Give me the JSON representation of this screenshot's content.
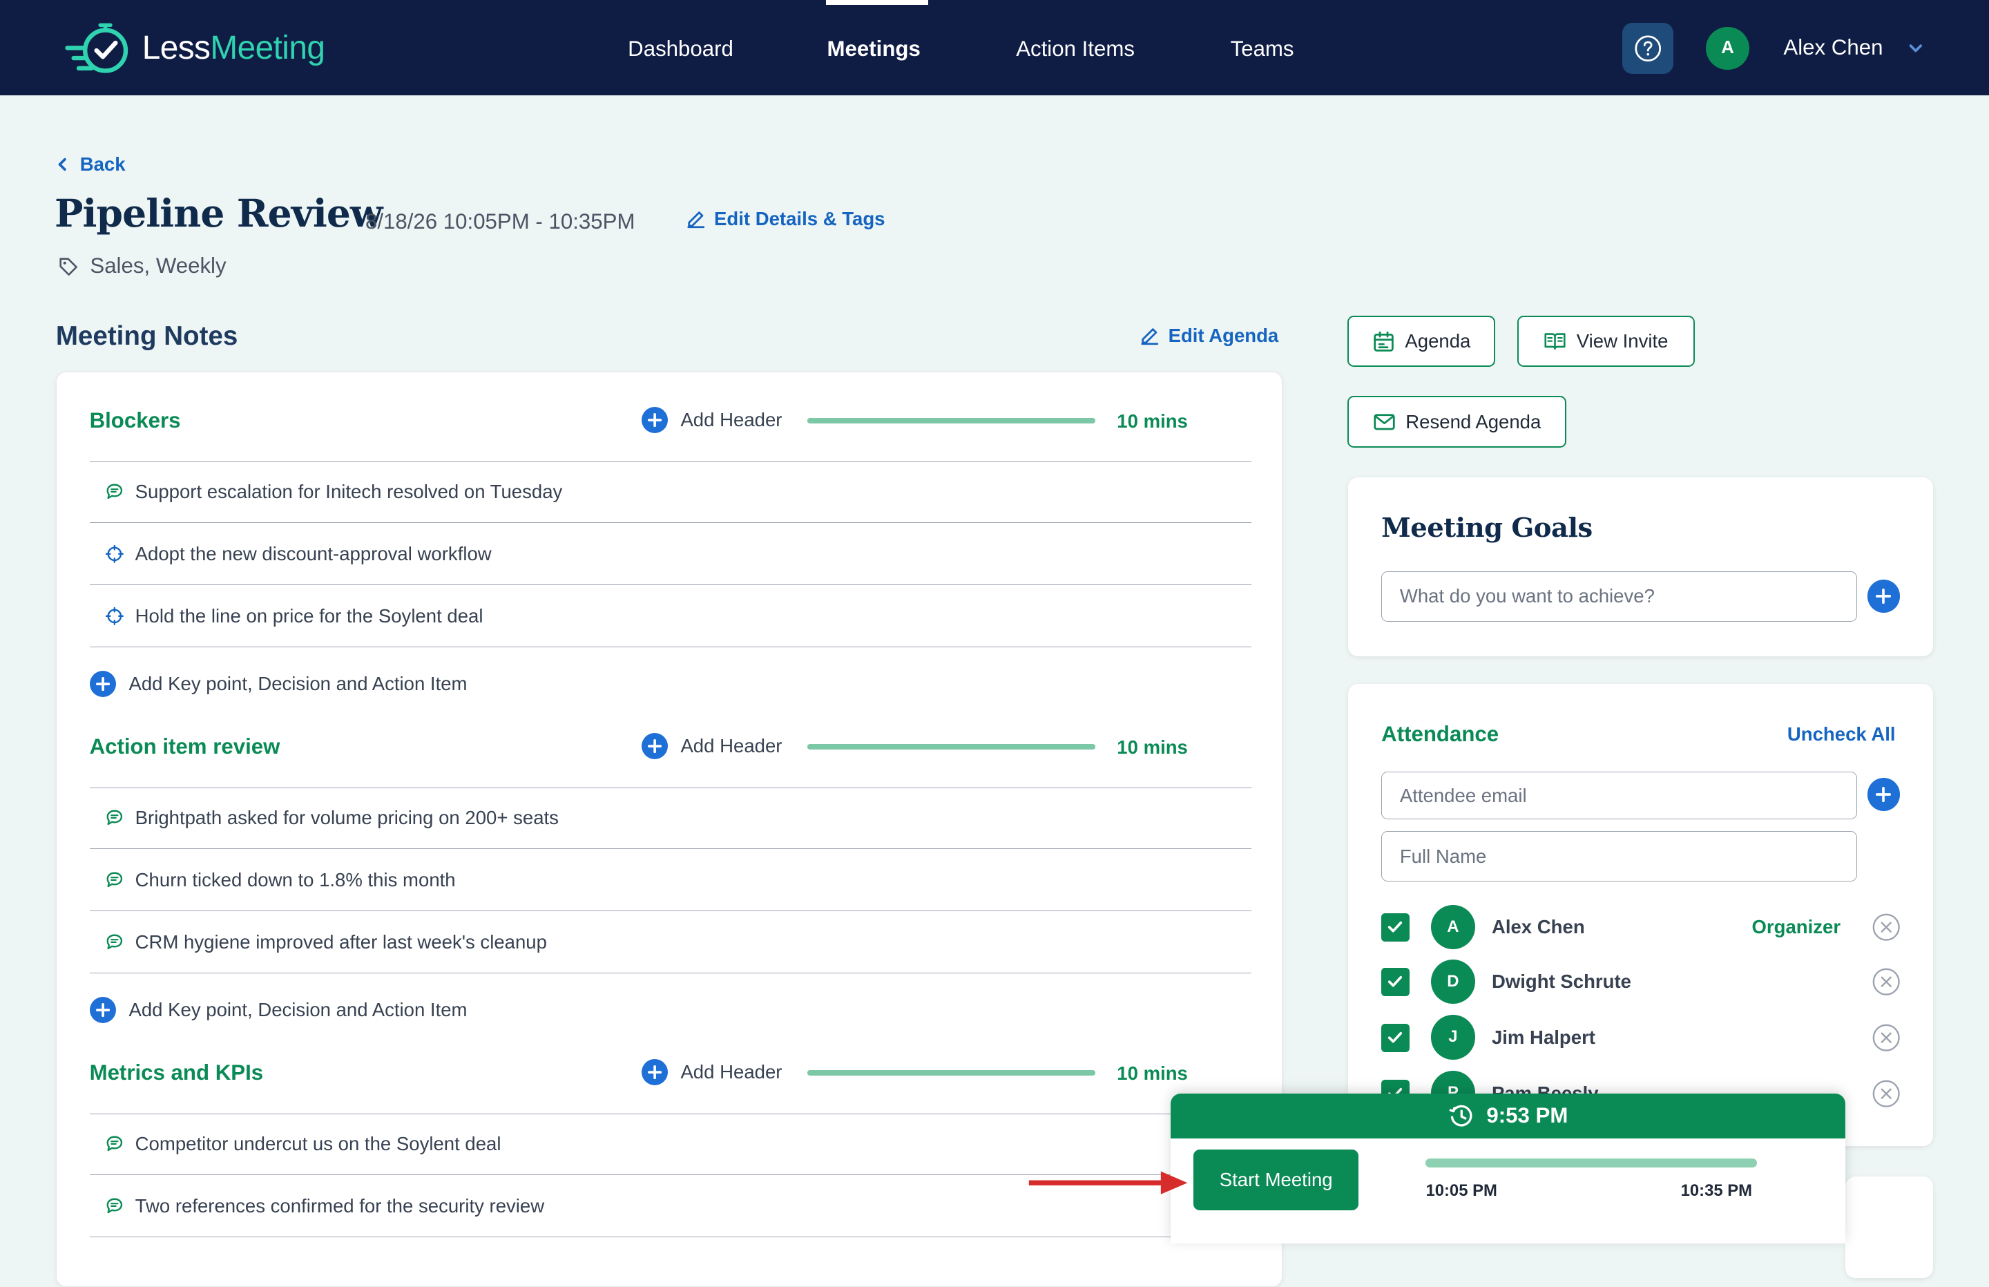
{
  "app": {
    "logo_part1": "Less",
    "logo_part2": "Meeting",
    "accent": "#0a8a55",
    "nav_bg": "#0f1c44",
    "link": "#1565c0"
  },
  "nav": {
    "items": [
      {
        "label": "Dashboard",
        "active": false
      },
      {
        "label": "Meetings",
        "active": true
      },
      {
        "label": "Action Items",
        "active": false
      },
      {
        "label": "Teams",
        "active": false
      }
    ],
    "help_icon": "question-circle-icon",
    "user_initial": "A",
    "user_name": "Alex Chen"
  },
  "page": {
    "back_label": "Back",
    "title": "Pipeline Review",
    "datetime": "8/18/26 10:05PM - 10:35PM",
    "edit_details_label": "Edit Details & Tags",
    "tags": "Sales, Weekly"
  },
  "notes": {
    "section_title": "Meeting Notes",
    "edit_agenda_label": "Edit Agenda",
    "add_header_label": "Add Header",
    "add_item_label": "Add Key point, Decision and Action Item",
    "items": [
      {
        "title": "Blockers",
        "duration": "10 mins",
        "notes": [
          {
            "type": "key-point",
            "text": "Support escalation for Initech resolved on Tuesday"
          },
          {
            "type": "decision",
            "text": "Adopt the new discount-approval workflow"
          },
          {
            "type": "decision",
            "text": "Hold the line on price for the Soylent deal"
          }
        ]
      },
      {
        "title": "Action item review",
        "duration": "10 mins",
        "notes": [
          {
            "type": "key-point",
            "text": "Brightpath asked for volume pricing on 200+ seats"
          },
          {
            "type": "key-point",
            "text": "Churn ticked down to 1.8% this month"
          },
          {
            "type": "key-point",
            "text": "CRM hygiene improved after last week's cleanup"
          }
        ]
      },
      {
        "title": "Metrics and KPIs",
        "duration": "10 mins",
        "notes": [
          {
            "type": "key-point",
            "text": "Competitor undercut us on the Soylent deal"
          },
          {
            "type": "key-point",
            "text": "Two references confirmed for the security review"
          }
        ]
      }
    ]
  },
  "actions": {
    "agenda_label": "Agenda",
    "view_invite_label": "View Invite",
    "resend_agenda_label": "Resend Agenda"
  },
  "goals": {
    "title": "Meeting Goals",
    "placeholder": "What do you want to achieve?"
  },
  "attendance": {
    "title": "Attendance",
    "uncheck_all_label": "Uncheck All",
    "email_placeholder": "Attendee email",
    "name_placeholder": "Full Name",
    "attendees": [
      {
        "initial": "A",
        "name": "Alex Chen",
        "role": "Organizer",
        "checked": true
      },
      {
        "initial": "D",
        "name": "Dwight Schrute",
        "role": "",
        "checked": true
      },
      {
        "initial": "J",
        "name": "Jim Halpert",
        "role": "",
        "checked": true
      },
      {
        "initial": "P",
        "name": "Pam Beesly",
        "role": "",
        "checked": true
      }
    ]
  },
  "timer": {
    "current_time": "9:53 PM",
    "start_button_label": "Start Meeting",
    "start_time": "10:05 PM",
    "end_time": "10:35 PM"
  }
}
